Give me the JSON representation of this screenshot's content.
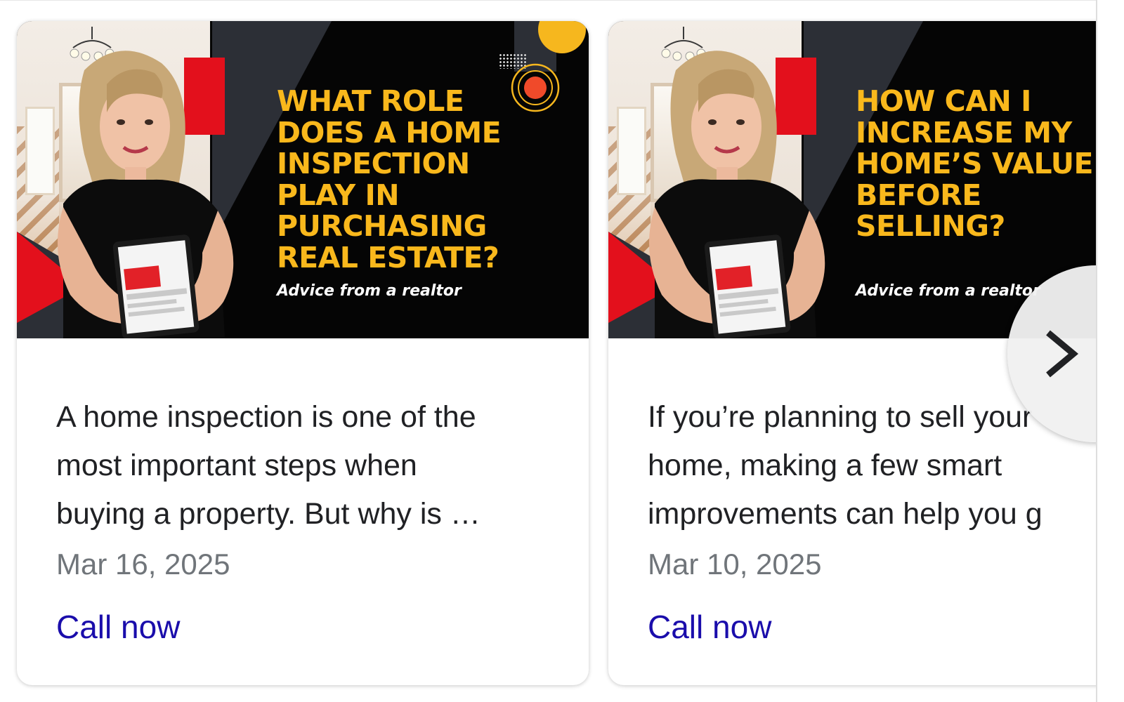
{
  "cards": [
    {
      "thumbnail": {
        "title_lines": [
          "WHAT ROLE",
          "DOES A HOME",
          "INSPECTION",
          "PLAY IN",
          "PURCHASING",
          "REAL ESTATE?"
        ],
        "subtitle": "Advice from a realtor"
      },
      "description_lines": [
        "A home inspection is one of the",
        "most important steps when",
        "buying a property. But why is …"
      ],
      "date": "Mar 16, 2025",
      "cta": "Call now"
    },
    {
      "thumbnail": {
        "title_lines": [
          "HOW CAN I",
          "INCREASE MY",
          "HOME’S VALUE",
          "BEFORE",
          "SELLING?"
        ],
        "subtitle": "Advice from a realtor"
      },
      "description_lines": [
        "If you’re planning to sell your",
        "home, making a few smart",
        "improvements can help you g"
      ],
      "date": "Mar 10, 2025",
      "cta": "Call now"
    }
  ],
  "carousel": {
    "next_icon": "chevron-right-icon"
  },
  "colors": {
    "thumbnail_title": "#f9b81c",
    "accent_red": "#e3101c",
    "accent_yellow": "#f6b71e",
    "link": "#1a0dab",
    "date": "#70757a",
    "text": "#202124"
  }
}
